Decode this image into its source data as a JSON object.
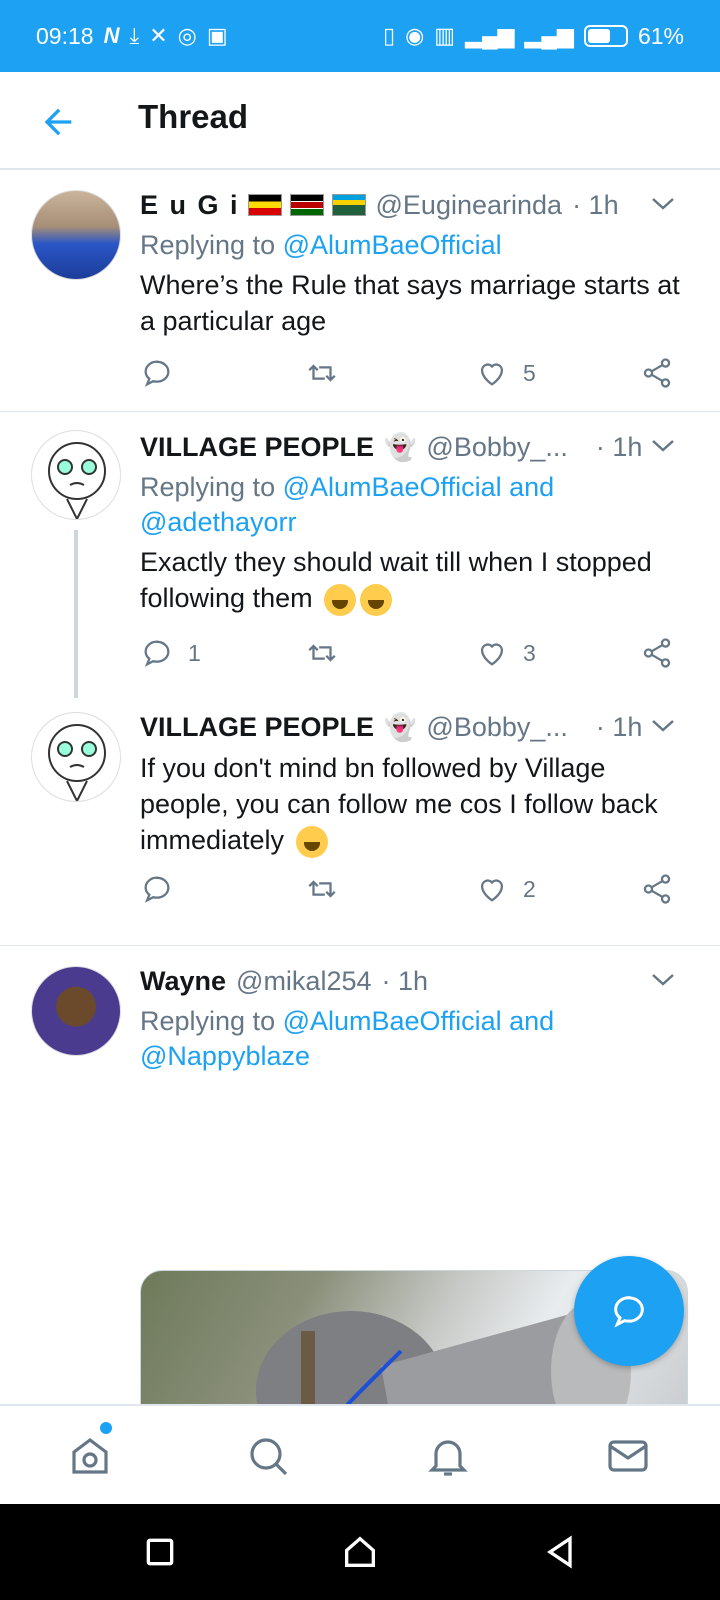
{
  "status_bar": {
    "time": "09:18",
    "battery": "61%",
    "battery_level": 0.61
  },
  "header": {
    "title": "Thread"
  },
  "tweets": [
    {
      "name": "E u G i",
      "handle": "@Euginearinda",
      "time": "· 1h",
      "replying_prefix": "Replying to ",
      "replying_to": "@AlumBaeOfficial",
      "text": "Where’s the Rule that says marriage starts at a particular age",
      "reply_count": "",
      "like_count": "5",
      "flags": [
        "uganda-flag",
        "kenya-flag",
        "rwanda-flag"
      ]
    },
    {
      "name": "VILLAGE PEOPLE",
      "handle": "@Bobby_...",
      "time": "· 1h",
      "replying_prefix": "Replying to ",
      "replying_to": "@AlumBaeOfficial and @adethayorr",
      "text": "Exactly they should wait till when I stopped following them",
      "reply_count": "1",
      "like_count": "3"
    },
    {
      "name": "VILLAGE PEOPLE",
      "handle": "@Bobby_...",
      "time": "· 1h",
      "text": "If you don't mind bn followed by Village people, you can follow me cos I follow back immediately",
      "reply_count": "",
      "like_count": "2"
    },
    {
      "name": "Wayne",
      "handle": "@mikal254",
      "time": "· 1h",
      "replying_prefix": "Replying to ",
      "replying_to": "@AlumBaeOfficial and @Nappyblaze"
    }
  ],
  "colors": {
    "accent": "#1da1f2",
    "text": "#14171a",
    "muted": "#657786",
    "divider": "#e1e8ed"
  },
  "icons": [
    "back-arrow-icon",
    "chevron-down-icon",
    "reply-icon",
    "retweet-icon",
    "like-icon",
    "share-icon",
    "compose-reply-icon",
    "home-icon",
    "search-icon",
    "notifications-icon",
    "messages-icon"
  ]
}
